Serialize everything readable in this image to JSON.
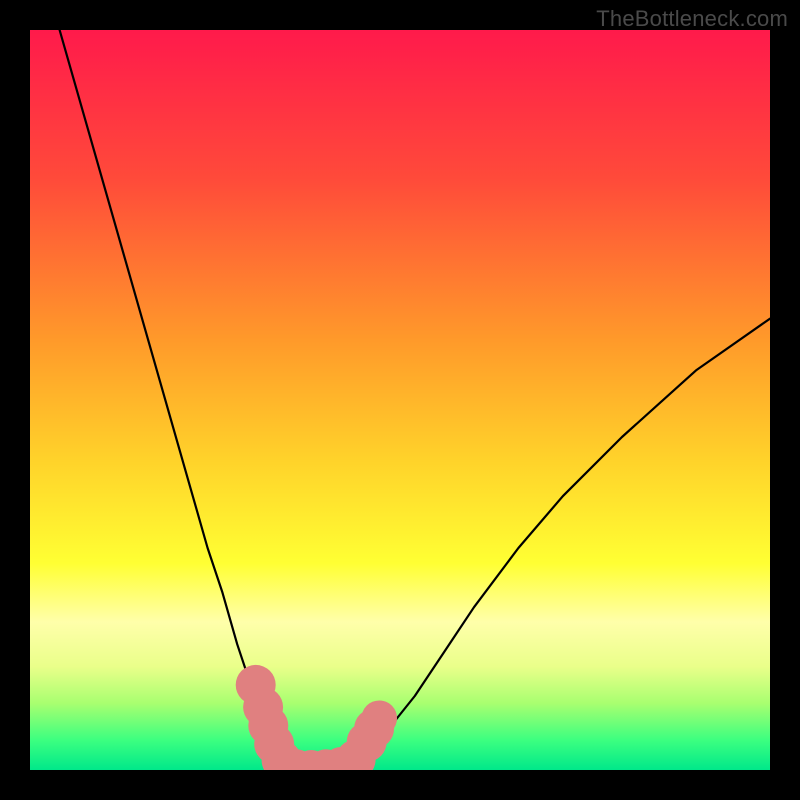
{
  "watermark": "TheBottleneck.com",
  "chart_data": {
    "type": "line",
    "title": "",
    "xlabel": "",
    "ylabel": "",
    "xlim": [
      0,
      100
    ],
    "ylim": [
      0,
      100
    ],
    "gradient_stops": [
      {
        "offset": 0,
        "color": "#ff1a4b"
      },
      {
        "offset": 20,
        "color": "#ff4a3a"
      },
      {
        "offset": 42,
        "color": "#ff9a2a"
      },
      {
        "offset": 58,
        "color": "#ffd22a"
      },
      {
        "offset": 72,
        "color": "#ffff33"
      },
      {
        "offset": 80,
        "color": "#ffffaa"
      },
      {
        "offset": 86,
        "color": "#eaff8a"
      },
      {
        "offset": 91,
        "color": "#a8ff70"
      },
      {
        "offset": 96,
        "color": "#3bff80"
      },
      {
        "offset": 100,
        "color": "#00e88a"
      }
    ],
    "series": [
      {
        "name": "left-branch",
        "x": [
          4,
          8,
          12,
          16,
          20,
          24,
          26,
          28,
          30,
          31,
          32,
          33,
          34
        ],
        "y": [
          100,
          86,
          72,
          58,
          44,
          30,
          24,
          17,
          11,
          8,
          5,
          3,
          1
        ]
      },
      {
        "name": "valley",
        "x": [
          34,
          36,
          38,
          40,
          42,
          44
        ],
        "y": [
          1,
          0.3,
          0.2,
          0.3,
          0.6,
          1.2
        ]
      },
      {
        "name": "right-branch",
        "x": [
          44,
          48,
          52,
          56,
          60,
          66,
          72,
          80,
          90,
          100
        ],
        "y": [
          1.2,
          5,
          10,
          16,
          22,
          30,
          37,
          45,
          54,
          61
        ]
      }
    ],
    "markers": [
      {
        "name": "left-marker-1",
        "x": 30.5,
        "y": 11.5,
        "r": 1.8
      },
      {
        "name": "left-marker-2",
        "x": 31.5,
        "y": 8.5,
        "r": 1.8
      },
      {
        "name": "left-marker-3",
        "x": 32.2,
        "y": 6.0,
        "r": 1.8
      },
      {
        "name": "left-marker-4",
        "x": 33.0,
        "y": 3.5,
        "r": 1.8
      },
      {
        "name": "left-marker-5",
        "x": 34.0,
        "y": 1.3,
        "r": 1.8
      },
      {
        "name": "valley-marker-1",
        "x": 36.0,
        "y": 0.4,
        "r": 1.6
      },
      {
        "name": "valley-marker-2",
        "x": 38.0,
        "y": 0.3,
        "r": 1.6
      },
      {
        "name": "valley-marker-3",
        "x": 40.0,
        "y": 0.4,
        "r": 1.6
      },
      {
        "name": "valley-marker-4",
        "x": 42.0,
        "y": 0.7,
        "r": 1.6
      },
      {
        "name": "right-marker-1",
        "x": 44.0,
        "y": 1.4,
        "r": 1.8
      },
      {
        "name": "right-marker-2",
        "x": 45.5,
        "y": 3.8,
        "r": 1.8
      },
      {
        "name": "right-marker-3",
        "x": 46.5,
        "y": 5.6,
        "r": 1.8
      },
      {
        "name": "right-marker-4",
        "x": 47.2,
        "y": 7.0,
        "r": 1.6
      }
    ],
    "marker_color": "#e08080",
    "curve_color": "#000000",
    "curve_width": 2.2
  }
}
